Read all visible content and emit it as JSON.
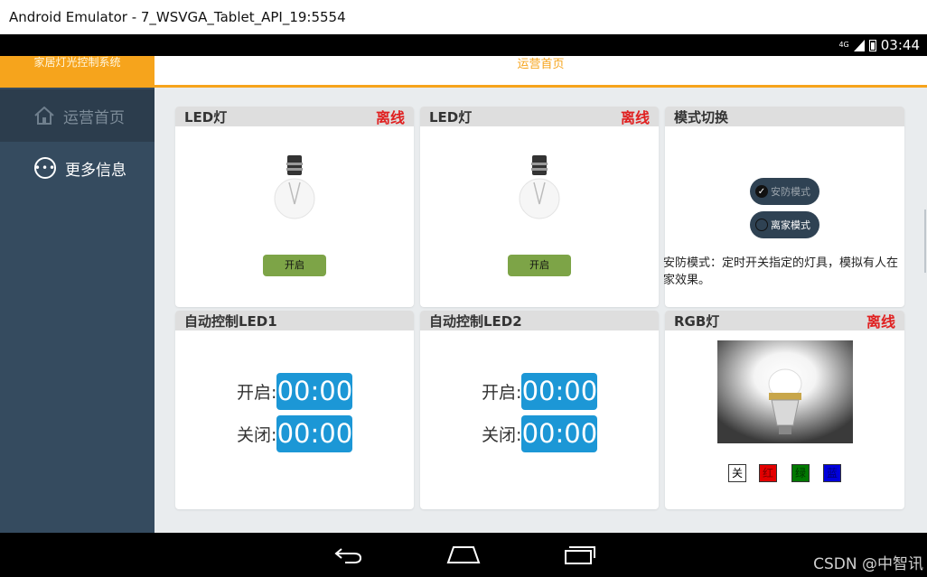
{
  "window": {
    "title": "Android Emulator - 7_WSVGA_Tablet_API_19:5554"
  },
  "status_bar": {
    "network": "4G",
    "time": "03:44"
  },
  "sidebar": {
    "brand": "家居灯光控制系统",
    "items": [
      {
        "label": "运营首页",
        "icon": "home-icon",
        "active": true
      },
      {
        "label": "更多信息",
        "icon": "more-icon",
        "active": false
      }
    ]
  },
  "header": {
    "title": "运营首页"
  },
  "cards": {
    "led1": {
      "title": "LED灯",
      "status": "离线",
      "button": "开启"
    },
    "led2": {
      "title": "LED灯",
      "status": "离线",
      "button": "开启"
    },
    "mode": {
      "title": "模式切换",
      "options": [
        "安防模式",
        "离家模式"
      ],
      "selected": "安防模式",
      "description": "安防模式：定时开关指定的灯具，模拟有人在家效果。"
    },
    "auto1": {
      "title": "自动控制LED1",
      "on_label": "开启:",
      "on_time": "00:00",
      "off_label": "关闭:",
      "off_time": "00:00"
    },
    "auto2": {
      "title": "自动控制LED2",
      "on_label": "开启:",
      "on_time": "00:00",
      "off_label": "关闭:",
      "off_time": "00:00"
    },
    "rgb": {
      "title": "RGB灯",
      "status": "离线",
      "buttons": [
        {
          "label": "关",
          "color": "#ffffff"
        },
        {
          "label": "红",
          "color": "#e30000"
        },
        {
          "label": "绿",
          "color": "#007a00"
        },
        {
          "label": "蓝",
          "color": "#0000dd"
        }
      ]
    }
  },
  "colors": {
    "accent": "#f6a41c",
    "sidebar": "#354b5f",
    "timer": "#1c97d6",
    "on_button": "#7da447",
    "offline": "#e02020"
  },
  "watermark": "CSDN @中智讯"
}
